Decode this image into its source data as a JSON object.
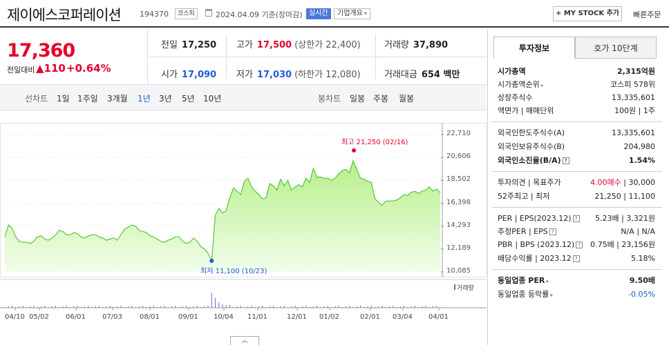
{
  "header": {
    "company": "제이에스코퍼레이션",
    "code": "194370",
    "market": "코스피",
    "date_text": "2024.04.09 기준(장마감)",
    "realtime_label": "실시간",
    "overview_label": "기업개요",
    "mystock_label": "+ MY STOCK 추가",
    "quick_order_label": "빠른주문"
  },
  "price": {
    "current": "17,360",
    "change_label": "전일대비",
    "change_value": "▲110",
    "change_pct": "+0.64%"
  },
  "stats": {
    "prev_label": "전일",
    "prev": "17,250",
    "high_label": "고가",
    "high": "17,500",
    "upper_limit": "(상한가 22,400)",
    "volume_label": "거래량",
    "volume": "37,890",
    "open_label": "시가",
    "open": "17,090",
    "low_label": "저가",
    "low": "17,030",
    "lower_limit": "(하한가 12,080)",
    "amount_label": "거래대금",
    "amount": "654 백만"
  },
  "toolbar": {
    "line_chart": "선차트",
    "periods": [
      "1일",
      "1주일",
      "3개월",
      "1년",
      "3년",
      "5년",
      "10년"
    ],
    "active_period": "1년",
    "candle_chart": "봉차트",
    "candle_periods": [
      "일봉",
      "주봉",
      "월봉"
    ]
  },
  "chart_data": {
    "type": "area",
    "y_ticks": [
      "22,710",
      "20,606",
      "18,502",
      "16,398",
      "14,293",
      "12,189",
      "10,085"
    ],
    "ylim": [
      10085,
      22710
    ],
    "x_ticks": [
      "04/10",
      "05/02",
      "06/01",
      "07/03",
      "08/01",
      "09/01",
      "10/04",
      "11/01",
      "12/01",
      "01/02",
      "02/01",
      "03/04",
      "04/01"
    ],
    "values": [
      13300,
      14400,
      14100,
      13300,
      12900,
      12800,
      12800,
      12700,
      12900,
      13300,
      13400,
      13100,
      13000,
      13200,
      13500,
      13900,
      13800,
      13500,
      13500,
      13700,
      13600,
      13300,
      13200,
      13400,
      13500,
      13500,
      13300,
      13200,
      13000,
      13100,
      13200,
      13000,
      13500,
      14000,
      14200,
      14400,
      14300,
      13900,
      13800,
      13700,
      13400,
      13300,
      13100,
      12900,
      12800,
      13000,
      13100,
      13300,
      13300,
      12900,
      12700,
      12800,
      13200,
      12900,
      12400,
      12200,
      11800,
      11100,
      15300,
      15900,
      15500,
      15700,
      16900,
      17800,
      17500,
      17200,
      18400,
      18700,
      17900,
      17500,
      17200,
      16800,
      16900,
      18200,
      18000,
      17600,
      18600,
      18000,
      18500,
      17600,
      17900,
      18100,
      17900,
      18700,
      18300,
      19600,
      18800,
      18800,
      18700,
      18700,
      18500,
      18700,
      19100,
      19400,
      19500,
      19200,
      20300,
      19500,
      18700,
      18600,
      18400,
      18300,
      16800,
      16500,
      16200,
      16600,
      16600,
      16600,
      16700,
      16900,
      17200,
      17100,
      17400,
      17500,
      17300,
      17500,
      17600,
      17900,
      17500,
      17700,
      17360
    ],
    "high_annotation": "최고 21,250 (02/16)",
    "low_annotation": "최저 11,100 (10/23)",
    "volume_label": "거래량"
  },
  "toggle_symbol": "︿",
  "right_panel": {
    "tabs": [
      "투자정보",
      "호가 10단계"
    ],
    "rows": [
      {
        "k": "시가총액",
        "v": "2,315억원",
        "bold": true
      },
      {
        "k": "시가총액순위",
        "v": "코스피 578위",
        "arrow": true
      },
      {
        "k": "상장주식수",
        "v": "13,335,601"
      },
      {
        "k": "액면가 | 매매단위",
        "v": "100원 | 1주"
      },
      {
        "k": "외국인한도주식수(A)",
        "v": "13,335,601"
      },
      {
        "k": "외국인보유주식수(B)",
        "v": "204,980"
      },
      {
        "k": "외국인소진율(B/A)",
        "v": "1.54%",
        "bold": true,
        "q": true
      },
      {
        "k": "투자의견 | 목표주가",
        "v": "4.00매수 | 30,000",
        "red_prefix": "4.00매수"
      },
      {
        "k": "52주최고 | 최저",
        "v": "21,250 | 11,100"
      },
      {
        "k": "PER | EPS(2023.12)",
        "v": "5.23배 | 3,321원",
        "q": true
      },
      {
        "k": "추정PER | EPS",
        "v": "N/A | N/A",
        "q": true
      },
      {
        "k": "PBR | BPS (2023.12)",
        "v": "0.75배 | 23,156원",
        "q": true
      },
      {
        "k": "배당수익률 | 2023.12",
        "v": "5.18%",
        "q": true
      },
      {
        "k": "동일업종 PER",
        "v": "9.50배",
        "bold": true,
        "arrow": true
      },
      {
        "k": "동일업종 등락률",
        "v": "-0.05%",
        "arrow": true,
        "blue": true
      }
    ]
  }
}
